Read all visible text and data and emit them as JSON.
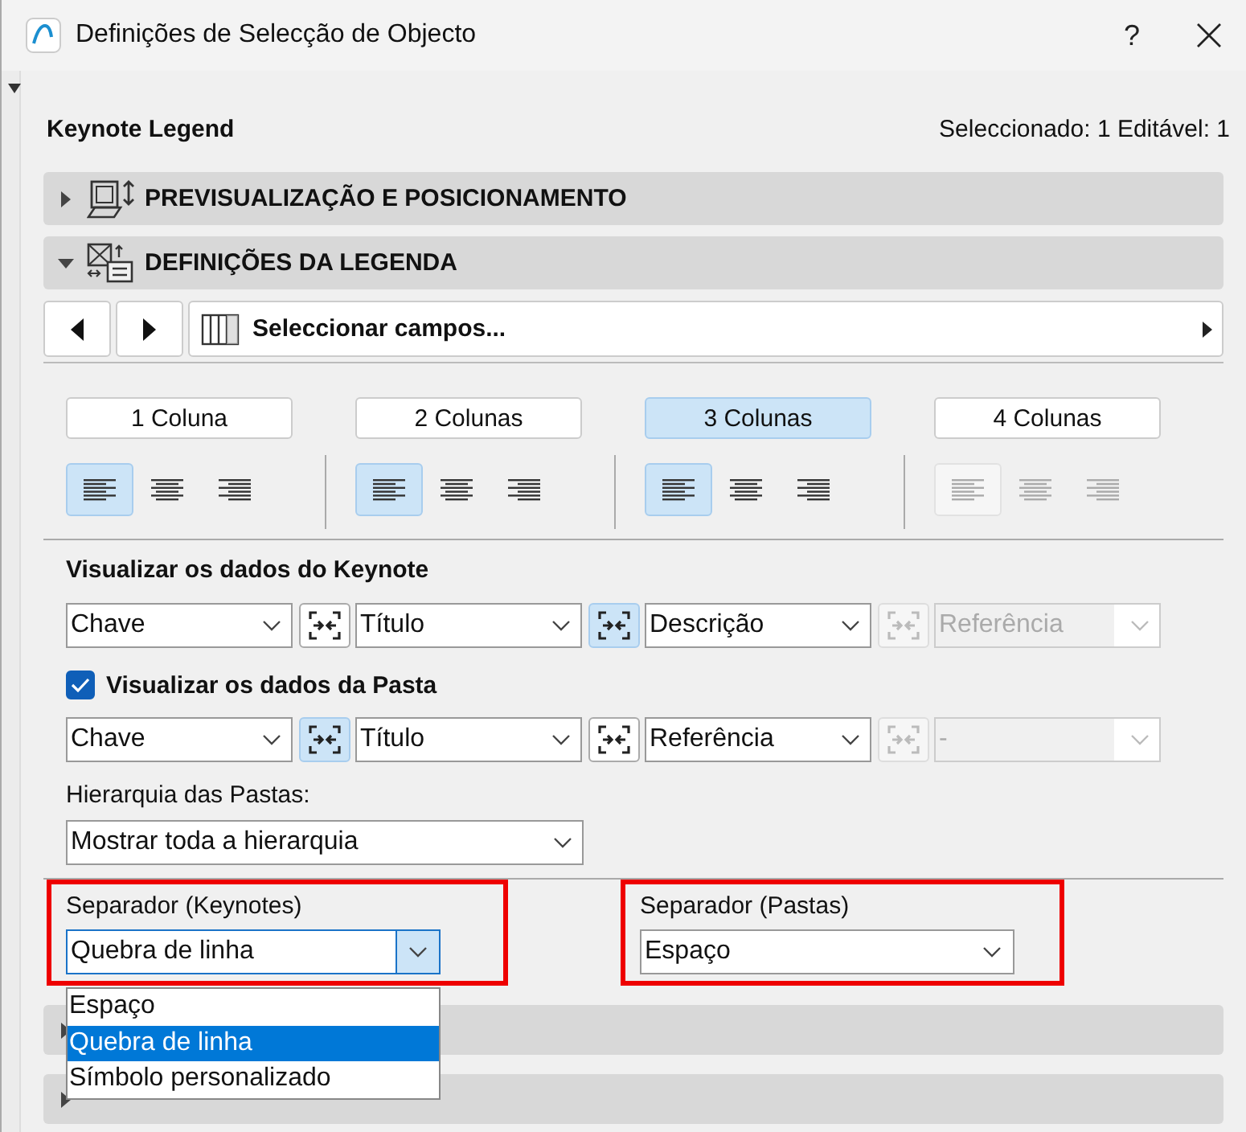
{
  "window": {
    "title": "Definições de Selecção de Objecto",
    "help": "?"
  },
  "header": {
    "name": "Keynote Legend",
    "status": "Seleccionado: 1 Editável: 1"
  },
  "sections": [
    {
      "title": "PREVISUALIZAÇÃO E POSICIONAMENTO",
      "expanded": false,
      "kind": "preview"
    },
    {
      "title": "DEFINIÇÕES DA LEGENDA",
      "expanded": true,
      "kind": "legend"
    }
  ],
  "toolbar": {
    "fields_button": "Seleccionar campos..."
  },
  "columns": [
    {
      "label": "1 Coluna",
      "selected": false,
      "disabled": false,
      "alignments": [
        {
          "kind": "left",
          "selected": true
        },
        {
          "kind": "center",
          "selected": false
        },
        {
          "kind": "right",
          "selected": false
        }
      ]
    },
    {
      "label": "2 Colunas",
      "selected": false,
      "disabled": false,
      "alignments": [
        {
          "kind": "left",
          "selected": true
        },
        {
          "kind": "center",
          "selected": false
        },
        {
          "kind": "right",
          "selected": false
        }
      ]
    },
    {
      "label": "3 Colunas",
      "selected": true,
      "disabled": false,
      "alignments": [
        {
          "kind": "left",
          "selected": true
        },
        {
          "kind": "center",
          "selected": false
        },
        {
          "kind": "right",
          "selected": false
        }
      ]
    },
    {
      "label": "4 Colunas",
      "selected": false,
      "disabled": false,
      "alignments": [
        {
          "kind": "left",
          "selected": true,
          "disabled": true
        },
        {
          "kind": "center",
          "selected": false,
          "disabled": true
        },
        {
          "kind": "right",
          "selected": false,
          "disabled": true
        }
      ]
    }
  ],
  "keynote_data": {
    "label": "Visualizar os dados do Keynote",
    "fields": [
      {
        "value": "Chave",
        "disabled": false,
        "link_selected": false,
        "link_disabled": false
      },
      {
        "value": "Título",
        "disabled": false,
        "link_selected": true,
        "link_disabled": false
      },
      {
        "value": "Descrição",
        "disabled": false,
        "link_selected": false,
        "link_disabled": true
      },
      {
        "value": "Referência",
        "disabled": true
      }
    ]
  },
  "folder_data": {
    "label": "Visualizar os dados da Pasta",
    "checked": true,
    "fields": [
      {
        "value": "Chave",
        "disabled": false,
        "link_selected": true,
        "link_disabled": false
      },
      {
        "value": "Título",
        "disabled": false,
        "link_selected": false,
        "link_disabled": false
      },
      {
        "value": "Referência",
        "disabled": false,
        "link_selected": false,
        "link_disabled": true
      },
      {
        "value": "-",
        "disabled": true
      }
    ]
  },
  "hierarchy": {
    "label": "Hierarquia das Pastas:",
    "value": "Mostrar toda a hierarquia"
  },
  "separators": [
    {
      "label": "Separador (Keynotes)",
      "value": "Quebra de linha",
      "highlighted": true,
      "open": true,
      "options": [
        {
          "label": "Espaço",
          "selected": false
        },
        {
          "label": "Quebra de linha",
          "selected": true
        },
        {
          "label": "Símbolo personalizado",
          "selected": false
        }
      ]
    },
    {
      "label": "Separador (Pastas)",
      "value": "Espaço",
      "highlighted": true,
      "open": false
    }
  ],
  "collapsed_sections": [
    {
      "expanded": false
    },
    {
      "expanded": false
    }
  ]
}
